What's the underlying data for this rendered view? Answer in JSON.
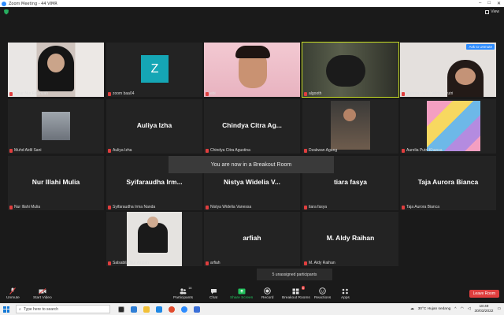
{
  "window": {
    "title": "Zoom Meeting - 44 VIMR"
  },
  "top": {
    "view_label": "View"
  },
  "tiles": [
    {
      "name": "Dinar Nur Fauziyah",
      "big": "",
      "video": true
    },
    {
      "name": "zoom baa04",
      "big": "",
      "avatar": "Z"
    },
    {
      "name": "ebi",
      "big": "",
      "video": true
    },
    {
      "name": "algooth",
      "big": "",
      "video": true,
      "active": true
    },
    {
      "name": "Rahma Vania Indriani Putri",
      "big": "",
      "video": true,
      "ask_unmute": "Ask to Unmute"
    },
    {
      "name": "Muhd Aidil Sani",
      "big": "",
      "video": true
    },
    {
      "name": "Auliya Izha",
      "big": "Auliya Izha"
    },
    {
      "name": "Chindya Citra Agustina",
      "big": "Chindya Citra Ag..."
    },
    {
      "name": "Dzakwan Agung",
      "big": "",
      "video": true
    },
    {
      "name": "Aurelia Putri Khansa",
      "big": "",
      "video": true
    },
    {
      "name": "Nur Illahi Mulia",
      "big": "Nur Illahi Mulia"
    },
    {
      "name": "Syifaraudha Irma Nanda",
      "big": "Syifaraudha  Irm..."
    },
    {
      "name": "Nistya Widelia Vanessa",
      "big": "Nistya Widelia V..."
    },
    {
      "name": "tiara fasya",
      "big": "tiara fasya"
    },
    {
      "name": "Taja Aurora Bianca",
      "big": "Taja Aurora Bianca"
    },
    {
      "name": "Salsabila Nur Azizah",
      "big": "",
      "video": true
    },
    {
      "name": "arfiah",
      "big": "arfiah"
    },
    {
      "name": "M. Aldy Raihan",
      "big": "M. Aldy Raihan"
    }
  ],
  "overlays": {
    "breakout": "You are now in a Breakout Room",
    "unassigned": "5 unassigned participants"
  },
  "toolbar": {
    "unmute": "Unmute",
    "start_video": "Start Video",
    "participants": "Participants",
    "participants_count": "18",
    "chat": "Chat",
    "share_screen": "Share Screen",
    "record": "Record",
    "breakout_rooms": "Breakout Rooms",
    "breakout_count": "8",
    "reactions": "Reactions",
    "apps": "Apps",
    "leave": "Leave Room"
  },
  "taskbar": {
    "search_placeholder": "Type here to search",
    "weather": "30°C  Hujan sedang",
    "time": "18:49",
    "date": "30/03/2022"
  },
  "colors": {
    "accent": "#2d8cff",
    "leave": "#e03e3e",
    "active_border": "#c8df25",
    "avatar": "#15a6b5"
  }
}
